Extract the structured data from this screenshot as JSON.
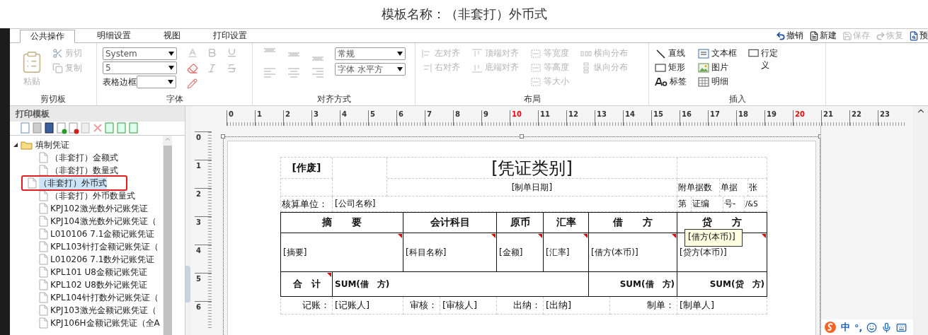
{
  "title": "模板名称：（非套打）外币式",
  "tabs": [
    {
      "label": "公共操作",
      "selected": true
    },
    {
      "label": "明细设置",
      "selected": false
    },
    {
      "label": "视图",
      "selected": false
    },
    {
      "label": "打印设置",
      "selected": false
    }
  ],
  "quick_actions": [
    {
      "kind": "undo",
      "label": "撤销",
      "disabled": false
    },
    {
      "kind": "new",
      "label": "新建",
      "disabled": false
    },
    {
      "kind": "save",
      "label": "保存",
      "disabled": true
    },
    {
      "kind": "redo",
      "label": "恢复",
      "disabled": true
    },
    {
      "kind": "preview",
      "label": "预",
      "disabled": false
    }
  ],
  "ribbon": {
    "clipboard": {
      "title": "剪切板",
      "paste": {
        "label": "粘贴",
        "disabled": true
      },
      "tools": [
        {
          "kind": "cut",
          "label": "剪切",
          "disabled": true
        },
        {
          "kind": "copy",
          "label": "复制",
          "disabled": true
        }
      ]
    },
    "font": {
      "title": "字体",
      "family": "System",
      "size": "5",
      "border_label": "表格边框"
    },
    "alignment": {
      "title": "对齐方式",
      "style": "常规",
      "direction": "字体 水平方"
    },
    "layout": {
      "title": "布局",
      "columns": [
        [
          {
            "kind": "align-left",
            "label": "左对齐",
            "disabled": true
          },
          {
            "kind": "align-right",
            "label": "右对齐",
            "disabled": true
          }
        ],
        [
          {
            "kind": "align-top",
            "label": "顶端对齐",
            "disabled": true
          },
          {
            "kind": "align-bottom",
            "label": "底端对齐",
            "disabled": true
          }
        ],
        [
          {
            "kind": "same-width",
            "label": "等宽度",
            "disabled": true
          },
          {
            "kind": "same-height",
            "label": "等高度",
            "disabled": true
          },
          {
            "kind": "same-size",
            "label": "等大小",
            "disabled": true
          }
        ],
        [
          {
            "kind": "distribute-h",
            "label": "横向分布",
            "disabled": true
          },
          {
            "kind": "distribute-v",
            "label": "纵向分布",
            "disabled": true
          }
        ]
      ]
    },
    "insert": {
      "title": "插入",
      "columns": [
        [
          {
            "kind": "line",
            "label": "直线",
            "disabled": false
          },
          {
            "kind": "rect",
            "label": "矩形",
            "disabled": false
          },
          {
            "kind": "label",
            "label": "标签",
            "disabled": false
          }
        ],
        [
          {
            "kind": "textbox",
            "label": "文本框",
            "disabled": false
          },
          {
            "kind": "image",
            "label": "图片",
            "disabled": false
          },
          {
            "kind": "detail",
            "label": "明细",
            "disabled": false
          }
        ],
        [
          {
            "kind": "rowdef",
            "label": "行定义",
            "disabled": false
          }
        ]
      ]
    }
  },
  "template_panel": {
    "title": "打印模板",
    "tree": [
      {
        "label": "填制凭证",
        "expanded": true,
        "children": [
          {
            "label": "（非套打）金额式",
            "selected": false,
            "marked": false
          },
          {
            "label": "（非套打）数量式",
            "selected": false,
            "marked": false
          },
          {
            "label": "（非套打）外币式",
            "selected": true,
            "marked": true
          },
          {
            "label": "（非套打）外币数量式",
            "selected": false,
            "marked": false
          },
          {
            "label": "KPJ102激光数外记账凭证",
            "selected": false,
            "marked": false
          },
          {
            "label": "KPJ104激光数外记账凭证（",
            "selected": false,
            "marked": false
          },
          {
            "label": "L010106 7.1金额记账凭证",
            "selected": false,
            "marked": false
          },
          {
            "label": "KPL103针打金额记账凭证（",
            "selected": false,
            "marked": false
          },
          {
            "label": "L010206 7.1数外记账凭证",
            "selected": false,
            "marked": false
          },
          {
            "label": "KPL101 U8金额记账凭证",
            "selected": false,
            "marked": false
          },
          {
            "label": "KPL102 U8数外记账凭证",
            "selected": false,
            "marked": false
          },
          {
            "label": "KPL104针打数外记账凭证（",
            "selected": false,
            "marked": false
          },
          {
            "label": "KPJ103激光金额记账凭证（",
            "selected": false,
            "marked": false
          },
          {
            "label": "KPJ106H金额记账凭证（全A",
            "selected": false,
            "marked": false
          }
        ]
      }
    ]
  },
  "ruler": {
    "horizontal": [
      {
        "label": "0",
        "color": "#333333"
      },
      {
        "label": "1",
        "color": "#333333"
      },
      {
        "label": "2",
        "color": "#333333"
      },
      {
        "label": "3",
        "color": "#333333"
      },
      {
        "label": "4",
        "color": "#333333"
      },
      {
        "label": "5",
        "color": "#333333"
      },
      {
        "label": "6",
        "color": "#333333"
      },
      {
        "label": "7",
        "color": "#333333"
      },
      {
        "label": "8",
        "color": "#333333"
      },
      {
        "label": "9",
        "color": "#333333"
      },
      {
        "label": "10",
        "color": "#ff0000"
      },
      {
        "label": "11",
        "color": "#333333"
      },
      {
        "label": "12",
        "color": "#333333"
      },
      {
        "label": "13",
        "color": "#333333"
      },
      {
        "label": "14",
        "color": "#333333"
      },
      {
        "label": "15",
        "color": "#333333"
      },
      {
        "label": "16",
        "color": "#333333"
      },
      {
        "label": "17",
        "color": "#333333"
      },
      {
        "label": "18",
        "color": "#333333"
      },
      {
        "label": "19",
        "color": "#333333"
      },
      {
        "label": "20",
        "color": "#ff0000"
      },
      {
        "label": "21",
        "color": "#333333"
      },
      {
        "label": "22",
        "color": "#333333"
      },
      {
        "label": "23",
        "color": "#333333"
      }
    ],
    "vertical": [
      "0",
      "1",
      "2",
      "3",
      "4",
      "5",
      "6"
    ]
  },
  "voucher": {
    "void_mark": "[作废]",
    "type": "[凭证类别]",
    "date": "[制单日期]",
    "attachments": [
      "附单据数",
      "单据",
      "张"
    ],
    "unit_label": "核算单位：",
    "company": "[公司名称]",
    "number_parts": [
      "第",
      "证编",
      "号-",
      "/&S"
    ],
    "columns": [
      "摘　　要",
      "会计科目",
      "原币",
      "汇率",
      "借　　方",
      "贷　　方"
    ],
    "detail": [
      "[摘要]",
      "[科目名称]",
      "[金额]",
      "[汇率]",
      "[借方(本币)]",
      "[贷方(本币)]"
    ],
    "total_label": "合　计",
    "sums": [
      "SUM(借　方)",
      "SUM(借　方)",
      "SUM(贷　方)"
    ],
    "signatures": [
      {
        "label": "记账：",
        "value": "[记账人]"
      },
      {
        "label": "审核：",
        "value": "[审核人]"
      },
      {
        "label": "出纳：",
        "value": "[出纳]"
      },
      {
        "label": "制单：",
        "value": "[制单人]"
      }
    ]
  },
  "tooltip": "[借方(本币)]",
  "ime": {
    "mode": "中",
    "punctuation": "°,"
  }
}
